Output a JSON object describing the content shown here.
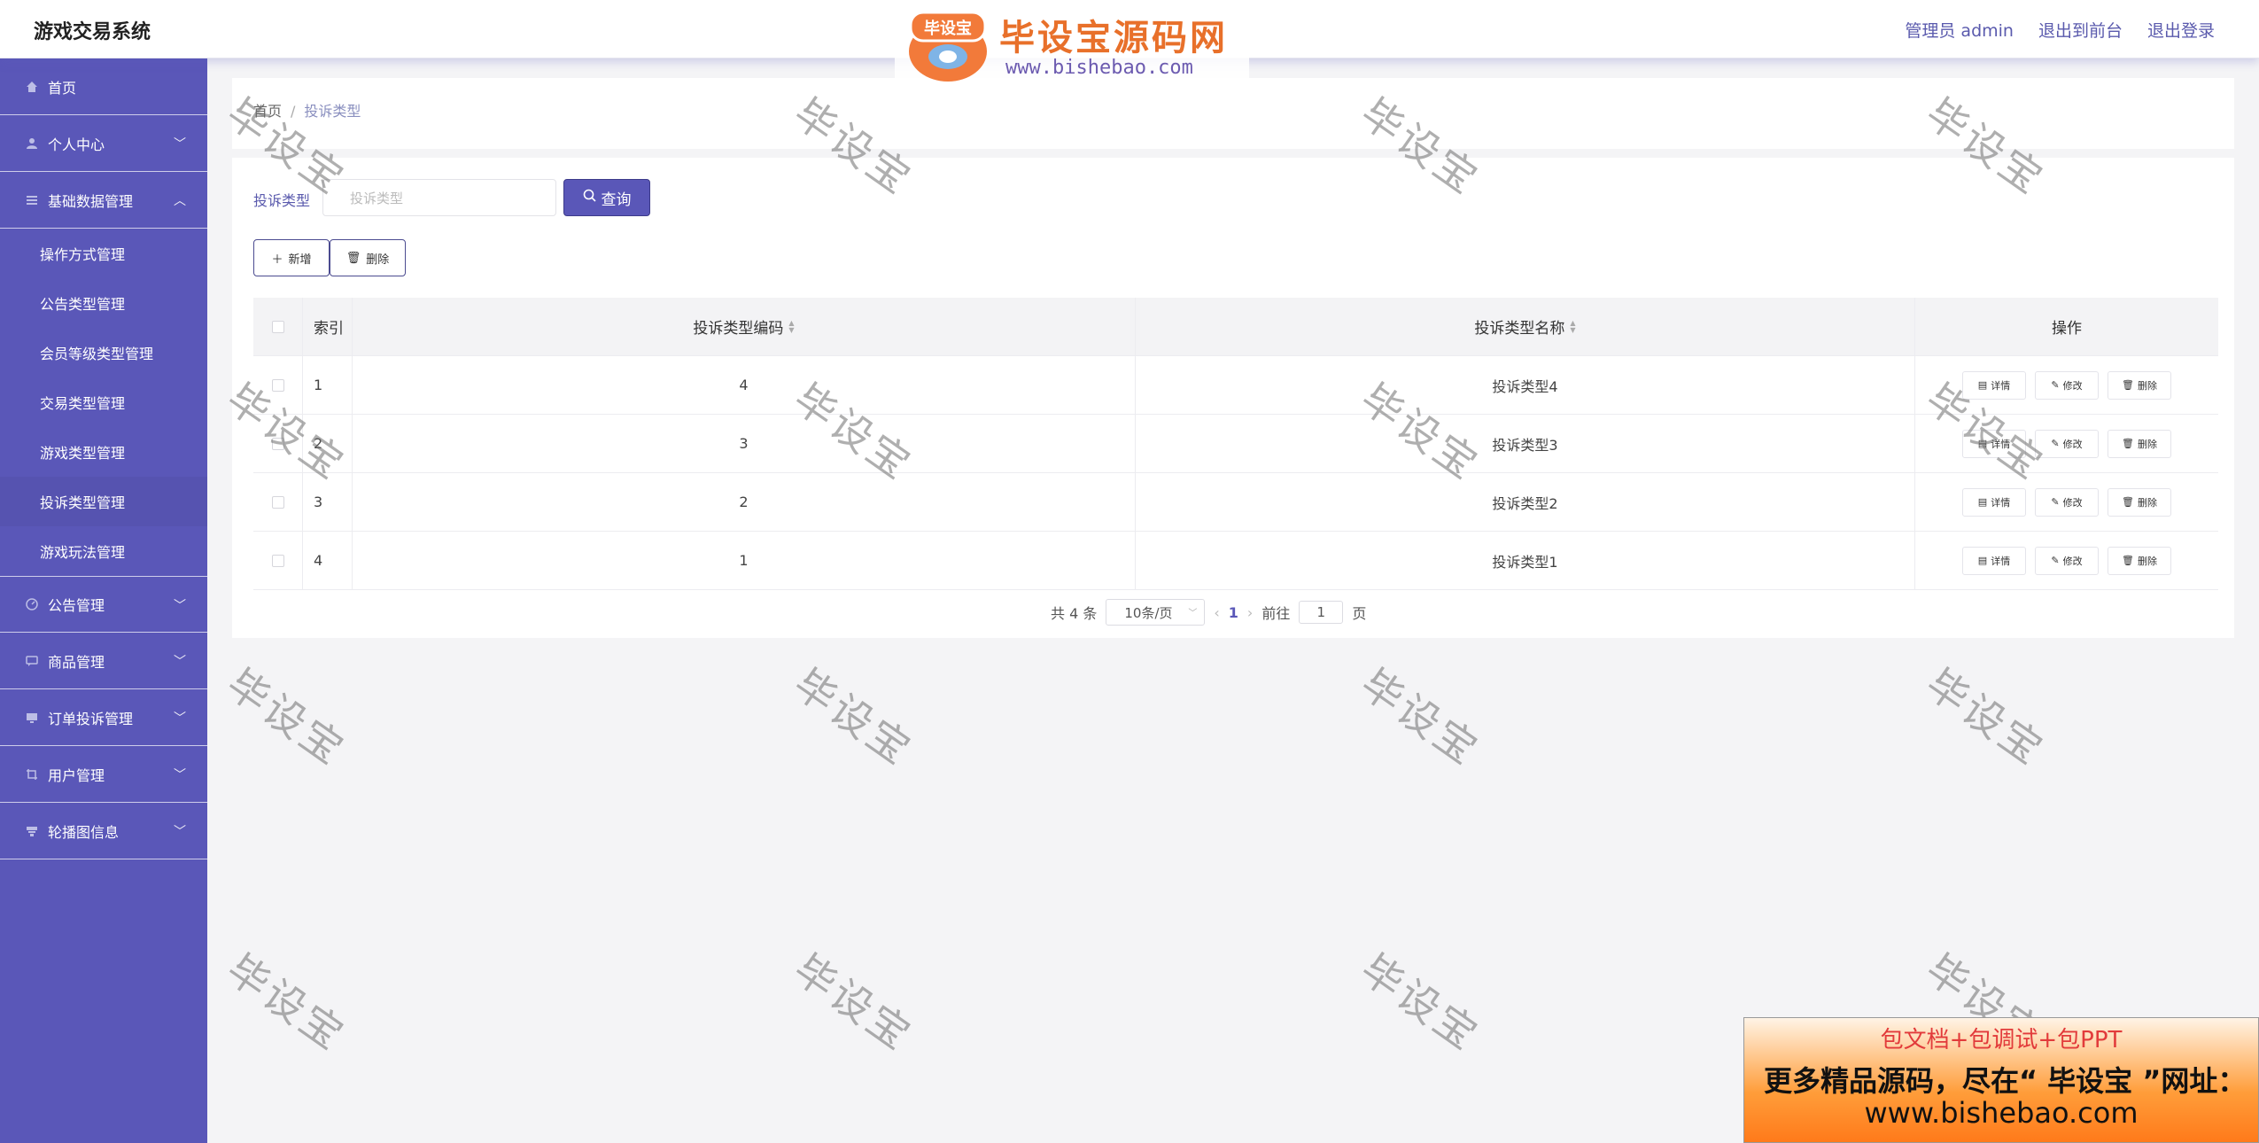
{
  "header": {
    "app_title": "游戏交易系统",
    "admin_label": "管理员 admin",
    "to_front": "退出到前台",
    "logout": "退出登录"
  },
  "logo_watermark": {
    "badge_text": "毕设宝",
    "title": "毕设宝源码网",
    "url": "www.bishebao.com"
  },
  "sidebar": {
    "items": [
      {
        "label": "首页",
        "icon": "home-icon",
        "expandable": false
      },
      {
        "label": "个人中心",
        "icon": "user-icon",
        "expandable": true
      },
      {
        "label": "基础数据管理",
        "icon": "list-icon",
        "expandable": true,
        "expanded": true,
        "children": [
          "操作方式管理",
          "公告类型管理",
          "会员等级类型管理",
          "交易类型管理",
          "游戏类型管理",
          "投诉类型管理",
          "游戏玩法管理"
        ]
      },
      {
        "label": "公告管理",
        "icon": "gauge-icon",
        "expandable": true
      },
      {
        "label": "商品管理",
        "icon": "chat-icon",
        "expandable": true
      },
      {
        "label": "订单投诉管理",
        "icon": "monitor-icon",
        "expandable": true
      },
      {
        "label": "用户管理",
        "icon": "crop-icon",
        "expandable": true
      },
      {
        "label": "轮播图信息",
        "icon": "stack-icon",
        "expandable": true
      }
    ],
    "active_child": "投诉类型管理"
  },
  "breadcrumb": {
    "home": "首页",
    "separator": "/",
    "current": "投诉类型"
  },
  "search": {
    "label": "投诉类型",
    "placeholder": "投诉类型",
    "button": "查询"
  },
  "actions": {
    "add": "新增",
    "delete": "删除"
  },
  "table": {
    "headers": {
      "index": "索引",
      "code": "投诉类型编码",
      "name": "投诉类型名称",
      "ops": "操作"
    },
    "rows": [
      {
        "index": "1",
        "code": "4",
        "name": "投诉类型4"
      },
      {
        "index": "2",
        "code": "3",
        "name": "投诉类型3"
      },
      {
        "index": "3",
        "code": "2",
        "name": "投诉类型2"
      },
      {
        "index": "4",
        "code": "1",
        "name": "投诉类型1"
      }
    ],
    "row_ops": {
      "detail": "详情",
      "edit": "修改",
      "delete": "删除"
    }
  },
  "pagination": {
    "total": "共 4 条",
    "page_size": "10条/页",
    "current_page": "1",
    "goto_prefix": "前往",
    "goto_value": "1",
    "goto_suffix": "页"
  },
  "watermark_text": "毕设宝",
  "ad": {
    "line1": "包文档+包调试+包PPT",
    "line2": "更多精品源码，尽在“ 毕设宝 ”网址：",
    "line3": "www.bishebao.com"
  },
  "colors": {
    "primary": "#5a57b8",
    "header_link": "#5a5aad"
  }
}
